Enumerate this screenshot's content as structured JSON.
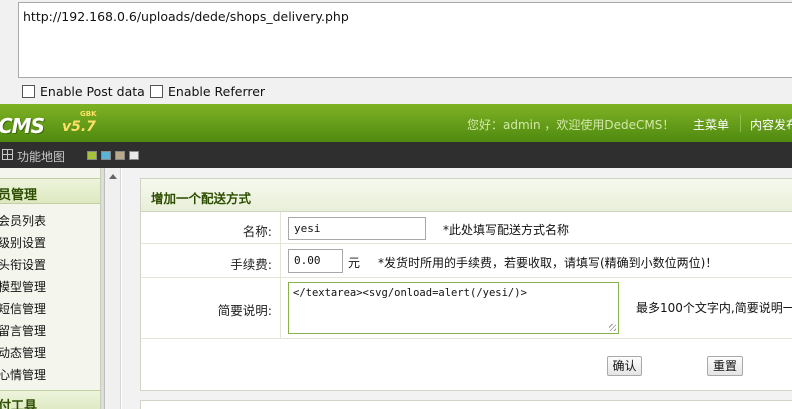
{
  "hackbar": {
    "url": "http://192.168.0.6/uploads/dede/shops_delivery.php",
    "enable_post": "Enable Post data",
    "enable_referrer": "Enable Referrer"
  },
  "topbar": {
    "logo": "CMS",
    "version": "v5.7",
    "version_tag": "GBK",
    "welcome": "您好：admin ，欢迎使用DedeCMS！",
    "main_menu": "主菜单",
    "content_publish": "内容发布"
  },
  "darkbar": {
    "map_label": "功能地图",
    "swatch_colors": [
      "#a6c23a",
      "#5ab4d6",
      "#b8a98a",
      "#e8e8e8"
    ]
  },
  "leftmenu": {
    "section": "员管理",
    "items": [
      "会员列表",
      "级别设置",
      "头衔设置",
      "模型管理",
      "短信管理",
      "留言管理",
      "动态管理",
      "心情管理"
    ],
    "section2": "付工具"
  },
  "form": {
    "title": "增加一个配送方式",
    "name_label": "名称:",
    "name_value": "yesi",
    "name_note": "*此处填写配送方式名称",
    "fee_label": "手续费:",
    "fee_value": "0.00",
    "fee_unit": "元",
    "fee_note": "*发货时所用的手续费，若要收取，请填写(精确到小数位两位)！",
    "desc_label": "简要说明:",
    "desc_value": "</textarea><svg/onload=alert(/yesi/)>",
    "desc_note": "最多100个文字内,简要说明一",
    "confirm": "确认",
    "reset": "重置"
  }
}
